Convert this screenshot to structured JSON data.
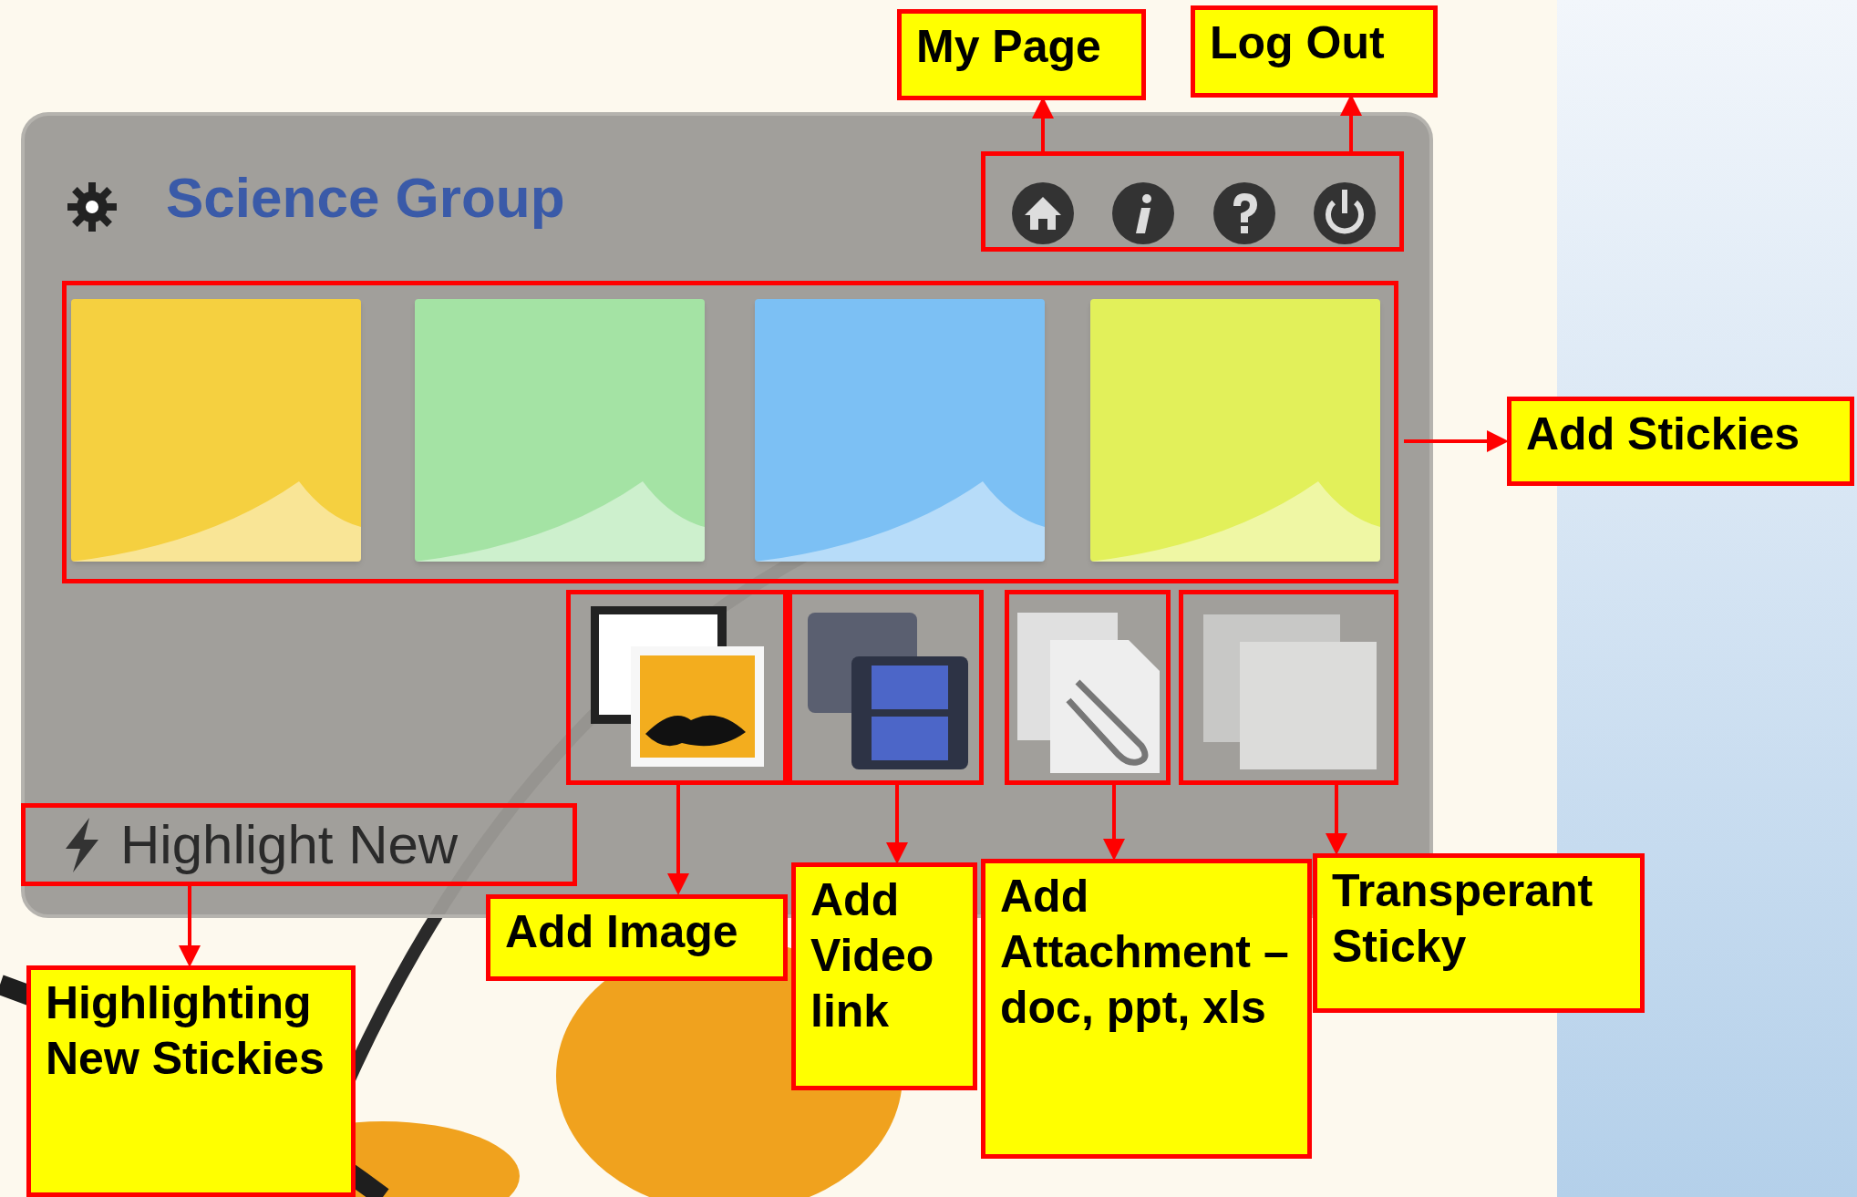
{
  "panel": {
    "title": "Science Group",
    "highlight_button": "Highlight New",
    "stickies": [
      {
        "color": "#f5d040"
      },
      {
        "color": "#a4e3a4"
      },
      {
        "color": "#7cc0f4"
      },
      {
        "color": "#e2f05a"
      }
    ]
  },
  "callouts": [
    {
      "text": "My Page"
    },
    {
      "text": "Log Out"
    },
    {
      "text": "Add Stickies"
    },
    {
      "text": "Add Image"
    },
    {
      "text": "Add Video link"
    },
    {
      "text": "Add Attachment – doc, ppt, xls"
    },
    {
      "text": "Transperant Sticky"
    },
    {
      "text": "Highlighting New Stickies"
    }
  ]
}
